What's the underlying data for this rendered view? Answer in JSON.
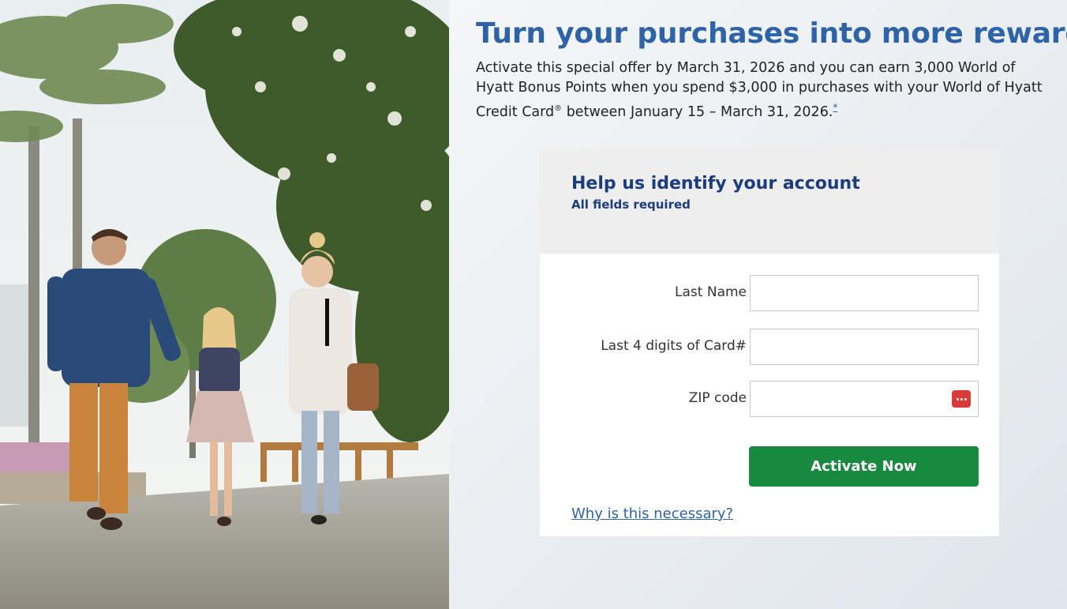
{
  "hero_image": {
    "alt": "Family walking hand in hand along a tree-lined path",
    "icon": "photo-family"
  },
  "offer": {
    "headline": "Turn your purchases into more rewards!",
    "intro_text_a": "Activate this special offer by March 31, 2026 and you can earn 3,000 World of Hyatt Bonus Points when you spend $3,000 in purchases with your World of Hyatt Credit Card",
    "registered_mark": "®",
    "intro_text_b": " between January 15 – March 31, 2026.",
    "footnote_link": "*"
  },
  "form": {
    "title": "Help us identify your account",
    "subtitle": "All fields required",
    "fields": [
      {
        "label": "Last Name",
        "value": ""
      },
      {
        "label": "Last 4 digits of Card#",
        "value": ""
      },
      {
        "label": "ZIP code",
        "value": "",
        "icon": "password-manager-icon"
      }
    ],
    "submit_label": "Activate Now",
    "help_link": "Why is this necessary?"
  },
  "colors": {
    "headline": "#2e63a8",
    "form_title": "#1a3c80",
    "button": "#188a3f",
    "link": "#2e63a8",
    "password_icon": "#d93a3a"
  }
}
